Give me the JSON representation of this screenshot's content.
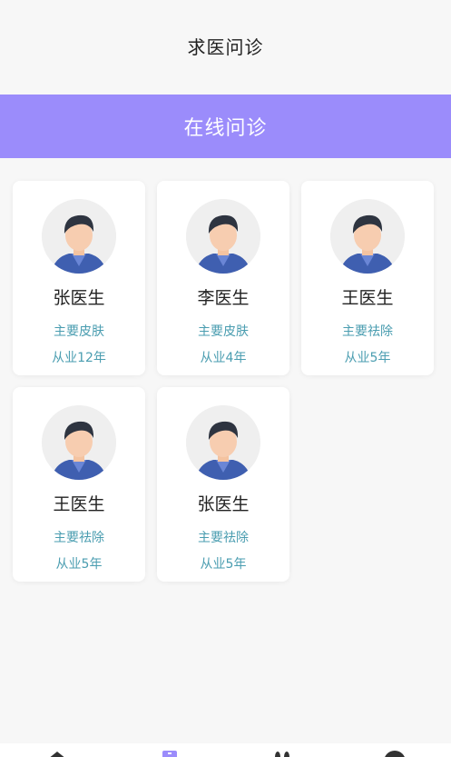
{
  "header": {
    "title": "求医问诊"
  },
  "banner": {
    "text": "在线问诊"
  },
  "doctors": [
    {
      "name": "张医生",
      "specialty": "主要皮肤",
      "experience": "从业12年"
    },
    {
      "name": "李医生",
      "specialty": "主要皮肤",
      "experience": "从业4年"
    },
    {
      "name": "王医生",
      "specialty": "主要祛除",
      "experience": "从业5年"
    },
    {
      "name": "王医生",
      "specialty": "主要祛除",
      "experience": "从业5年"
    },
    {
      "name": "张医生",
      "specialty": "主要祛除",
      "experience": "从业5年"
    }
  ],
  "colors": {
    "accent": "#9b8cfb",
    "info_text": "#4a9db0"
  },
  "tabbar": {
    "icons": [
      "home-icon",
      "consult-icon",
      "rabbit-icon",
      "profile-icon"
    ]
  }
}
